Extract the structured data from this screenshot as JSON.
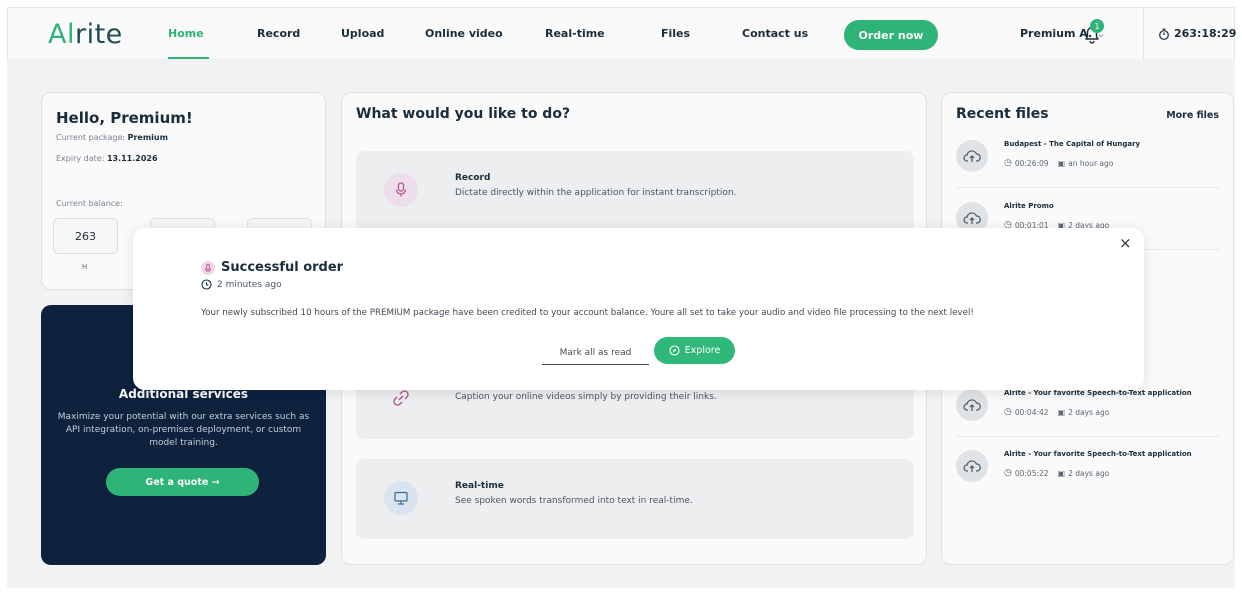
{
  "header": {
    "logo": {
      "accent": "Al",
      "rest": "rite"
    },
    "nav": [
      "Home",
      "Record",
      "Upload",
      "Online video",
      "Real-time",
      "Files",
      "Contact us"
    ],
    "order_label": "Order now",
    "user_label": "Premium A.",
    "user_chevron": "⌄",
    "notification_count": "1",
    "timer": "263:18:29"
  },
  "greeting": {
    "title": "Hello, Premium!",
    "package_label": "Current package:",
    "package_value": "Premium",
    "expiry_label": "Expiry date:",
    "expiry_value": "13.11.2026",
    "balance_label": "Current balance:",
    "balance_hours": "263",
    "balance_hours_unit": "H"
  },
  "services": {
    "title": "Additional services",
    "description": "Maximize your potential with our extra services such as API integration, on-premises deployment, or custom model training.",
    "quote_label": "Get a quote →"
  },
  "main": {
    "title": "What would you like to do?",
    "tiles": [
      {
        "title": "Record",
        "desc": "Dictate directly within the application for instant transcription."
      },
      {
        "title": "",
        "desc": "Caption your online videos simply by providing their links."
      },
      {
        "title": "Real-time",
        "desc": "See spoken words transformed into text in real-time."
      }
    ]
  },
  "recent": {
    "title": "Recent files",
    "more_label": "More files",
    "files": [
      {
        "name": "Budapest - The Capital of Hungary",
        "duration": "00:26:09",
        "when": "an hour ago"
      },
      {
        "name": "Alrite Promo",
        "duration": "00:01:01",
        "when": "2 days ago"
      },
      {
        "name": "Alrite - Your favorite Speech-to-Text application",
        "duration": "00:04:42",
        "when": "2 days ago"
      },
      {
        "name": "Alrite - Your favorite Speech-to-Text application",
        "duration": "00:05:22",
        "when": "2 days ago"
      }
    ]
  },
  "modal": {
    "close": "×",
    "title": "Successful order",
    "time_ago": "2 minutes ago",
    "message": "Your newly subscribed 10 hours of the PREMIUM package have been credited to your account balance. Youre all set to take your audio and video file processing to the next level!",
    "mark_read_label": "Mark all as read",
    "explore_label": "Explore"
  },
  "colors": {
    "accent": "#2fb87a",
    "navy": "#0f2340",
    "text": "#1b2e3c"
  }
}
